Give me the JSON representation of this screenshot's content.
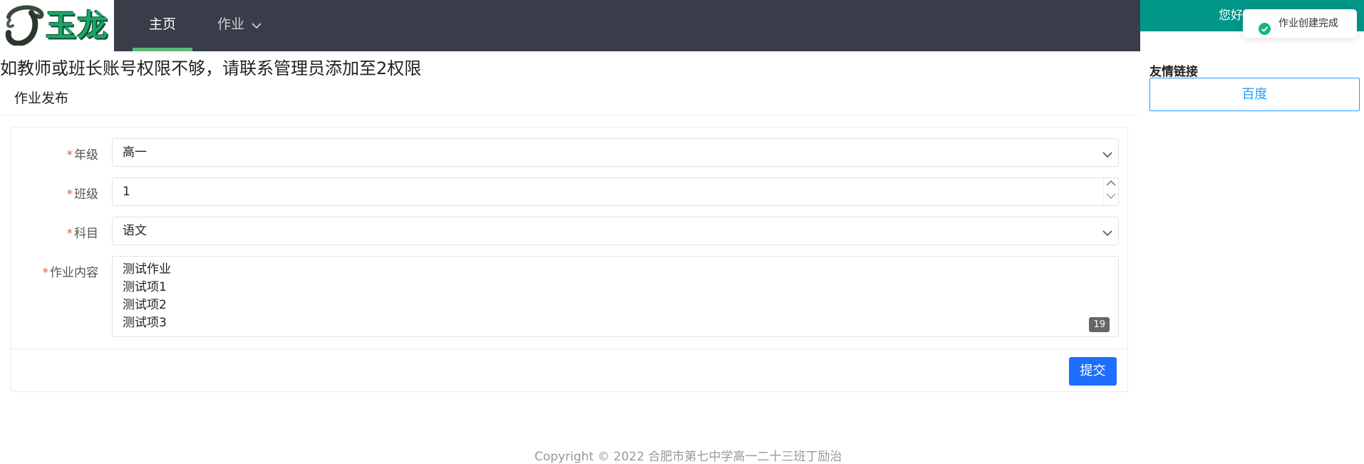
{
  "logo": {
    "text": "玉龙",
    "icon": "jade-dragon-logo"
  },
  "nav": {
    "items": [
      {
        "label": "主页",
        "active": true
      },
      {
        "label": "作业",
        "has_dropdown": true
      }
    ]
  },
  "user": {
    "greeting": "您好"
  },
  "toast": {
    "message": "作业创建完成",
    "icon": "check-circle-icon",
    "color": "#16b777"
  },
  "notice": "如教师或班长账号权限不够，请联系管理员添加至2权限",
  "card": {
    "title": "作业发布"
  },
  "form": {
    "grade": {
      "label": "年级",
      "value": "高一"
    },
    "class": {
      "label": "班级",
      "value": "1"
    },
    "subject": {
      "label": "科目",
      "value": "语文"
    },
    "content": {
      "label": "作业内容",
      "lines": [
        "测试作业",
        "测试项1",
        "测试项2",
        "测试项3"
      ],
      "char_count": "19"
    },
    "submit_label": "提交",
    "required_mark": "*"
  },
  "links": {
    "title": "友情链接",
    "items": [
      {
        "label": "百度"
      }
    ]
  },
  "footer": "Copyright © 2022 合肥市第七中学高一二十三班丁励治",
  "colors": {
    "nav_bg": "#393d49",
    "nav_active": "#5fb878",
    "accent": "#009688",
    "primary_button": "#1e6fff",
    "link": "#1e9fff",
    "required": "#ff5722"
  }
}
